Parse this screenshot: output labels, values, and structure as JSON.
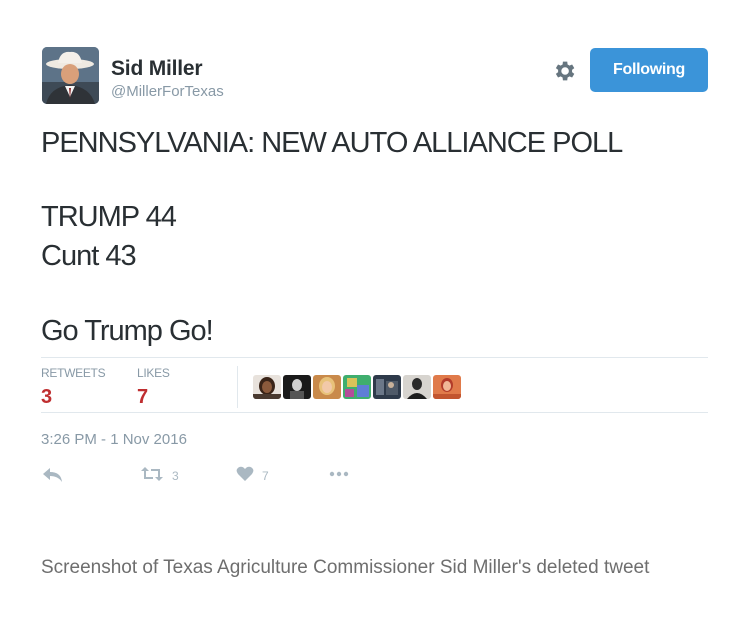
{
  "author": {
    "display_name": "Sid Miller",
    "handle": "@MillerForTexas",
    "avatar": "avatar-man-in-cowboy-hat"
  },
  "header": {
    "follow_button_label": "Following",
    "settings_icon": "gear-icon"
  },
  "tweet": {
    "lines": [
      "PENNSYLVANIA: NEW AUTO ALLIANCE POLL",
      "TRUMP 44",
      "Cunt 43",
      "Go Trump Go!"
    ],
    "retweets_label": "RETWEETS",
    "retweets_count": "3",
    "likes_label": "LIKES",
    "likes_count": "7",
    "timestamp": "3:26 PM - 1 Nov 2016",
    "liker_avatar_count": 7
  },
  "actions": {
    "reply_icon": "reply-icon",
    "retweet_icon": "retweet-icon",
    "retweet_count": "3",
    "like_icon": "heart-icon",
    "like_count": "7",
    "more_icon": "more-dots-icon"
  },
  "caption": "Screenshot of Texas Agriculture Commissioner Sid Miller's deleted tweet",
  "colors": {
    "follow_button": "#3b94d9",
    "stat_numbers": "#bf2e30",
    "muted_text": "#8899a6",
    "action_icons": "#aab8c2",
    "divider": "#e1e8ed"
  }
}
